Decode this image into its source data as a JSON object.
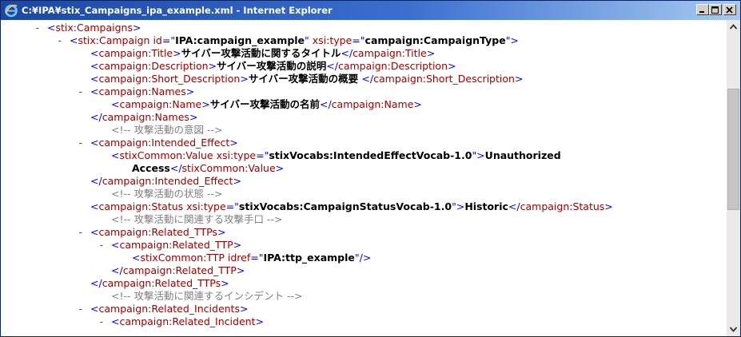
{
  "window": {
    "title": "C:¥IPA¥stix_Campaigns_ipa_example.xml - Internet Explorer",
    "icon": "internet-explorer-icon"
  },
  "xml": {
    "l1": {
      "marker": "-",
      "open": "<",
      "tag": "stix:Campaigns",
      "close": ">"
    },
    "l2": {
      "marker": "-",
      "open": "<",
      "tag": "stix:Campaign",
      "attr1": "id",
      "val1": "IPA:campaign_example",
      "attr2": "xsi:type",
      "val2": "campaign:CampaignType",
      "close": ">"
    },
    "l3": {
      "tag": "campaign:Title",
      "text": "サイバー攻撃活動に関するタイトル"
    },
    "l4": {
      "tag": "campaign:Description",
      "text": "サイバー攻撃活動の説明"
    },
    "l5": {
      "tag": "campaign:Short_Description",
      "text": "サイバー攻撃活動の概要 "
    },
    "l6": {
      "marker": "-",
      "tag": "campaign:Names"
    },
    "l7": {
      "tag": "campaign:Name",
      "text": "サイバー攻撃活動の名前"
    },
    "l8": {
      "tag": "campaign:Names"
    },
    "l9": {
      "comment": "<!-- 攻撃活動の意図 -->"
    },
    "l10": {
      "marker": "-",
      "tag": "campaign:Intended_Effect"
    },
    "l11": {
      "tag": "stixCommon:Value",
      "attr": "xsi:type",
      "val": "stixVocabs:IntendedEffectVocab-1.0",
      "text": "Unauthorized"
    },
    "l12": {
      "text": "Access",
      "tag": "stixCommon:Value"
    },
    "l13": {
      "tag": "campaign:Intended_Effect"
    },
    "l14": {
      "comment": "<!-- 攻撃活動の状態 -->"
    },
    "l15": {
      "tag": "campaign:Status",
      "attr": "xsi:type",
      "val": "stixVocabs:CampaignStatusVocab-1.0",
      "text": "Historic"
    },
    "l16": {
      "comment": "<!-- 攻撃活動に関連する攻撃手口 -->"
    },
    "l17": {
      "marker": "-",
      "tag": "campaign:Related_TTPs"
    },
    "l18": {
      "marker": "-",
      "tag": "campaign:Related_TTP"
    },
    "l19": {
      "tag": "stixCommon:TTP",
      "attr": "idref",
      "val": "IPA:ttp_example"
    },
    "l20": {
      "tag": "campaign:Related_TTP"
    },
    "l21": {
      "tag": "campaign:Related_TTPs"
    },
    "l22": {
      "comment": "<!-- 攻撃活動に関連するインシデント -->"
    },
    "l23": {
      "marker": "-",
      "tag": "campaign:Related_Incidents"
    },
    "l24": {
      "marker": "-",
      "tag": "campaign:Related_Incident"
    }
  }
}
